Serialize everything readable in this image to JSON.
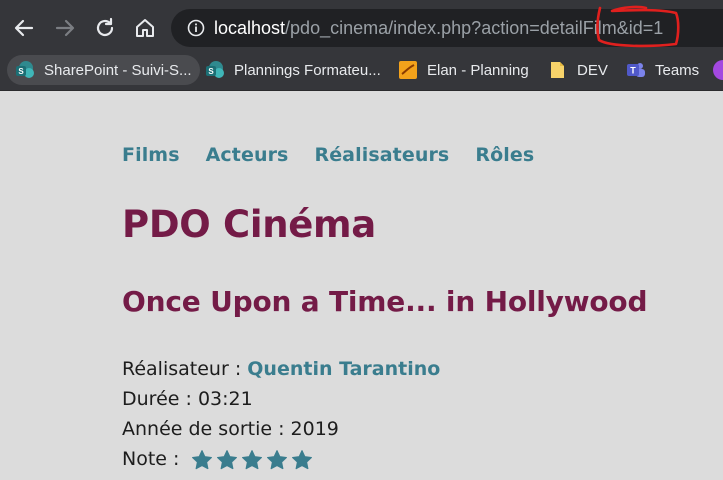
{
  "browser": {
    "url_host": "localhost",
    "url_path": "/pdo_cinema/index.php?action=detailFilm&id=1",
    "bookmarks": [
      {
        "label": "SharePoint - Suivi-S...",
        "icon": "sharepoint-icon"
      },
      {
        "label": "Plannings Formateu...",
        "icon": "sharepoint-icon"
      },
      {
        "label": "Elan - Planning",
        "icon": "elan-icon"
      },
      {
        "label": "DEV",
        "icon": "folder-icon"
      },
      {
        "label": "Teams",
        "icon": "teams-icon"
      }
    ]
  },
  "nav": {
    "items": [
      "Films",
      "Acteurs",
      "Réalisateurs",
      "Rôles"
    ]
  },
  "site_title": "PDO Cinéma",
  "film": {
    "title": "Once Upon a Time... in Hollywood",
    "director_label": "Réalisateur : ",
    "director": "Quentin Tarantino",
    "duration_label": "Durée : ",
    "duration": "03:21",
    "year_label": "Année de sortie : ",
    "year": "2019",
    "rating_label": "Note : ",
    "rating": 5,
    "rating_max": 5
  },
  "colors": {
    "accent": "#3a7d8e",
    "title": "#741b47",
    "annotation": "#e0201e"
  }
}
